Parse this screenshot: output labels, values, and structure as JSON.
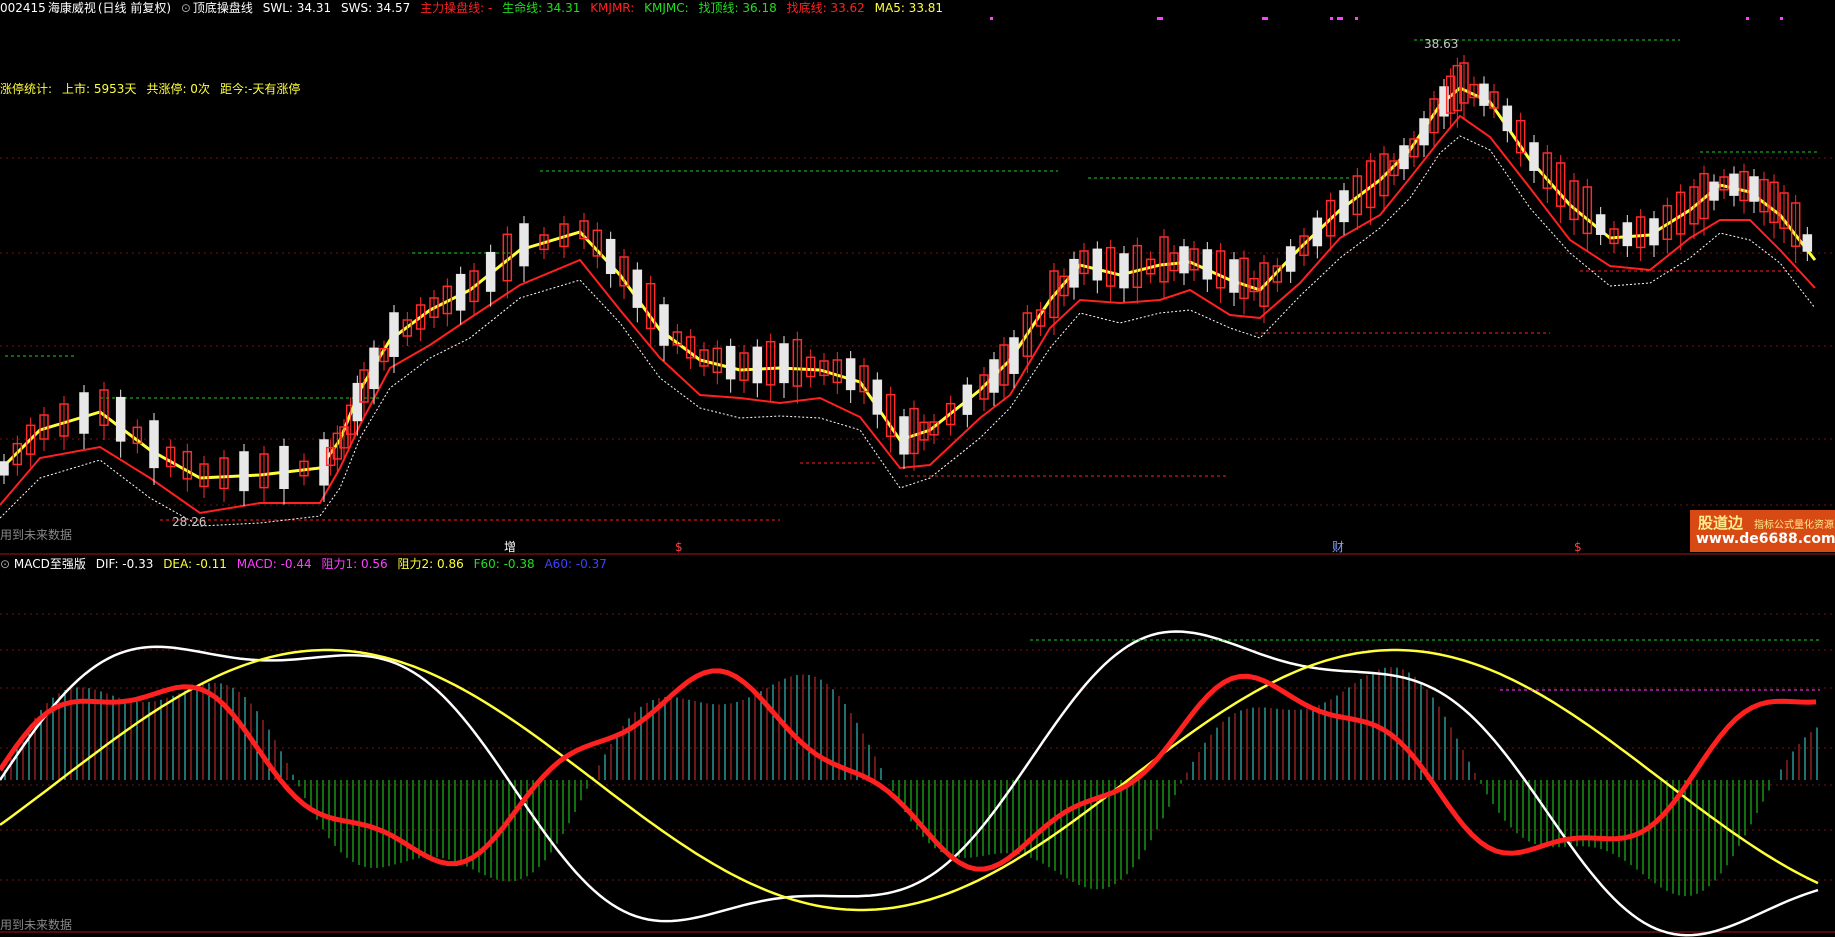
{
  "header": {
    "stock_code": "002415",
    "stock_name": "海康威视",
    "period": "(日线 前复权)",
    "indicator_name": "顶底操盘线",
    "swl": "SWL: 34.31",
    "sws": "SWS: 34.57",
    "main_line": "主力操盘线: -",
    "life_line": "生命线: 34.31",
    "kmjmr": "KMJMR:",
    "kmjmc": "KMJMC:",
    "top_line": "找顶线: 36.18",
    "bottom_line": "找底线: 33.62",
    "ma5": "MA5: 33.81"
  },
  "limit_stats": {
    "label": "涨停统计:",
    "listed": "上市: 5953天",
    "count": "共涨停: 0次",
    "since": "距今:-天有涨停"
  },
  "price_labels": {
    "high": "38.63",
    "low": "28.26"
  },
  "future_data_upper": "用到未来数据",
  "future_data_lower": "用到未来数据",
  "event_markers": [
    "增",
    "$",
    "财",
    "$"
  ],
  "macd_header": {
    "name": "MACD至强版",
    "dif": "DIF: -0.33",
    "dea": "DEA: -0.11",
    "macd": "MACD: -0.44",
    "r1": "阻力1: 0.56",
    "r2": "阻力2: 0.86",
    "f60": "F60: -0.38",
    "a60": "A60: -0.37"
  },
  "watermark": {
    "brand": "股道边",
    "tagline": "指标公式量化资源",
    "url": "www.de6688.com"
  },
  "colors": {
    "up": "#ff2a2a",
    "down": "#e8e8e8",
    "yellow": "#ffff3c",
    "green": "#22dd22",
    "red": "#ff2020",
    "magenta": "#ff40ff",
    "cyan": "#40e0e0",
    "orange": "#f0b020",
    "blue": "#4040ff"
  }
}
